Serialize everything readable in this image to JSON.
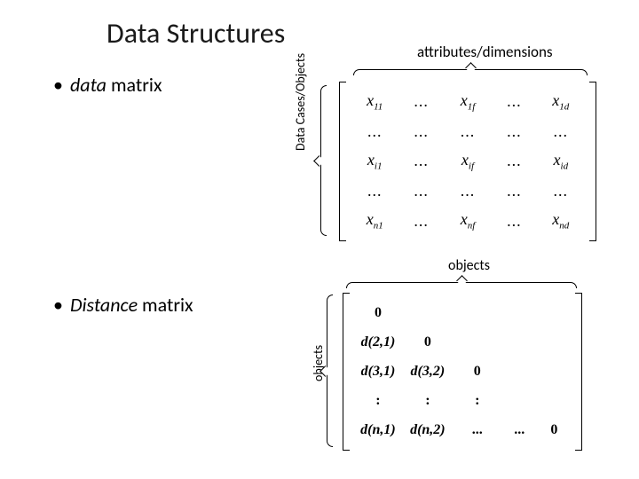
{
  "title": "Data Structures",
  "labels": {
    "attributes": "attributes/dimensions",
    "data_cases": "Data Cases/Objects",
    "objects": "objects"
  },
  "bullets": {
    "b1_emph": "data",
    "b1_rest": " matrix",
    "b2_emph": "Distance",
    "b2_rest": " matrix"
  },
  "matrix1": {
    "rows": [
      [
        {
          "x": "x",
          "sub": "11"
        },
        {
          "d": "..."
        },
        {
          "x": "x",
          "sub": "1f"
        },
        {
          "d": "..."
        },
        {
          "x": "x",
          "sub": "1d"
        }
      ],
      [
        {
          "d": "..."
        },
        {
          "d": "..."
        },
        {
          "d": "..."
        },
        {
          "d": "..."
        },
        {
          "d": "..."
        }
      ],
      [
        {
          "x": "x",
          "sub": "i1"
        },
        {
          "d": "..."
        },
        {
          "x": "x",
          "sub": "if"
        },
        {
          "d": "..."
        },
        {
          "x": "x",
          "sub": "id"
        }
      ],
      [
        {
          "d": "..."
        },
        {
          "d": "..."
        },
        {
          "d": "..."
        },
        {
          "d": "..."
        },
        {
          "d": "..."
        }
      ],
      [
        {
          "x": "x",
          "sub": "n1"
        },
        {
          "d": "..."
        },
        {
          "x": "x",
          "sub": "nf"
        },
        {
          "d": "..."
        },
        {
          "x": "x",
          "sub": "nd"
        }
      ]
    ]
  },
  "matrix2": {
    "rows": [
      [
        "0",
        "",
        "",
        "",
        ""
      ],
      [
        "d(2,1)",
        "0",
        "",
        "",
        ""
      ],
      [
        "d(3,1)",
        "d(3,2)",
        "0",
        "",
        ""
      ],
      [
        ":",
        ":",
        ":",
        "",
        ""
      ],
      [
        "d(n,1)",
        "d(n,2)",
        "...",
        "...",
        "0"
      ]
    ]
  }
}
